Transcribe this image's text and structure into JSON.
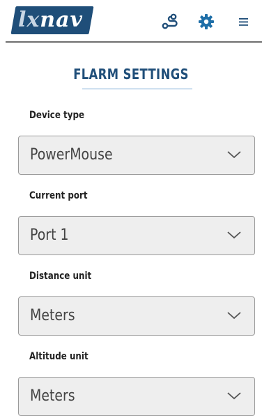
{
  "header": {
    "logo_prefix": "lx",
    "logo_suffix": "nav",
    "icons": [
      "route-icon",
      "gear-icon",
      "hamburger-menu-icon"
    ],
    "accent_color": "#1f4e79",
    "icon_color": "#1f4e79"
  },
  "page": {
    "title": "FLARM SETTINGS"
  },
  "fields": [
    {
      "label": "Device type",
      "value": "PowerMouse"
    },
    {
      "label": "Current port",
      "value": "Port 1"
    },
    {
      "label": "Distance unit",
      "value": "Meters"
    },
    {
      "label": "Altitude unit",
      "value": "Meters"
    }
  ]
}
